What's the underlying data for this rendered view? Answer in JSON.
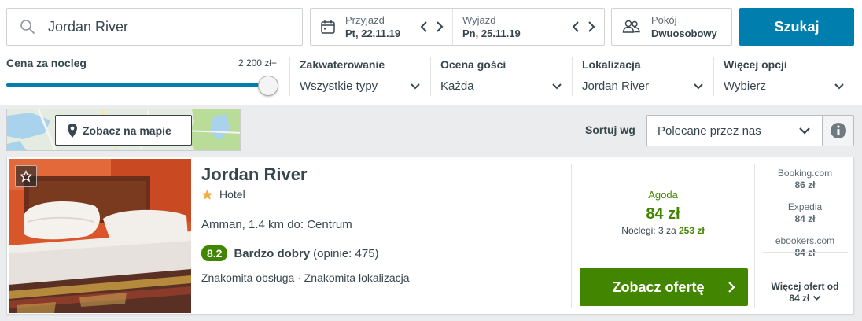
{
  "search": {
    "destination": "Jordan River",
    "button_label": "Szukaj"
  },
  "dates": {
    "checkin_label": "Przyjazd",
    "checkin_value": "Pt, 22.11.19",
    "checkout_label": "Wyjazd",
    "checkout_value": "Pn, 25.11.19"
  },
  "room": {
    "label": "Pokój",
    "value": "Dwuosobowy"
  },
  "filters": {
    "price": {
      "label": "Cena za nocleg",
      "max": "2 200 zł+",
      "level_percent": 100
    },
    "accommodation": {
      "label": "Zakwaterowanie",
      "value": "Wszystkie typy"
    },
    "rating": {
      "label": "Ocena gości",
      "value": "Każda"
    },
    "location": {
      "label": "Lokalizacja",
      "value": "Jordan River"
    },
    "more": {
      "label": "Więcej opcji",
      "value": "Wybierz"
    }
  },
  "map": {
    "button_label": "Zobacz na mapie"
  },
  "sort": {
    "label": "Sortuj wg",
    "value": "Polecane przez nas"
  },
  "result": {
    "name": "Jordan River",
    "stars": 1,
    "type": "Hotel",
    "location": "Amman, 1.4 km do: Centrum",
    "rating_score": "8.2",
    "rating_text": "Bardzo dobry",
    "rating_count": "(opinie: 475)",
    "highlights": "Znakomita obsługa · Znakomita lokalizacja",
    "deal": {
      "provider": "Agoda",
      "price": "84 zł",
      "nights_prefix": "Noclegi: 3 za",
      "nights_total": "253 zł",
      "button_label": "Zobacz ofertę"
    },
    "alternatives": [
      {
        "name": "Booking.com",
        "price": "86 zł"
      },
      {
        "name": "Expedia",
        "price": "84 zł"
      },
      {
        "name": "ebookers.com",
        "price": "84 zł"
      }
    ],
    "more_label": "Więcej ofert od",
    "more_price": "84 zł"
  },
  "colors": {
    "primary_blue": "#007faf",
    "deal_green": "#428500",
    "text": "#37454d"
  },
  "icons": [
    "search-icon",
    "calendar-icon",
    "chevron-left-icon",
    "chevron-right-icon",
    "people-icon",
    "chevron-down-icon",
    "map-pin-icon",
    "info-icon",
    "star-outline-icon",
    "star-icon"
  ]
}
